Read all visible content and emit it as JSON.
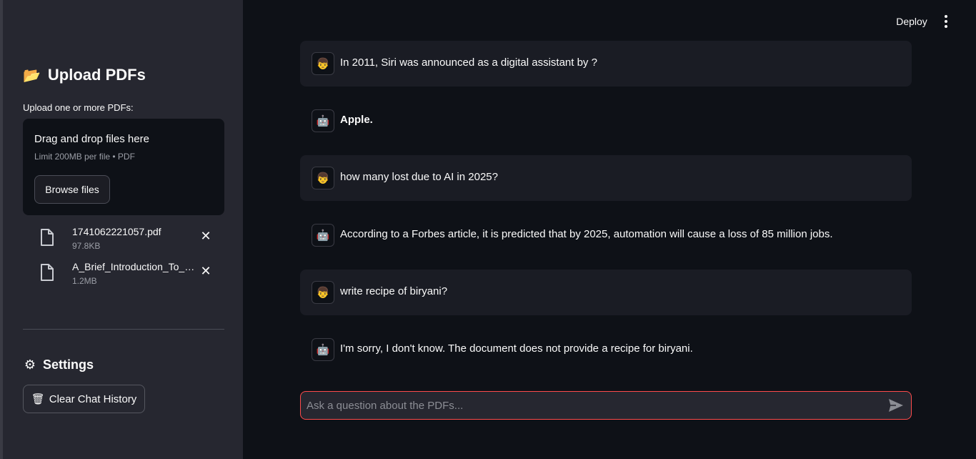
{
  "sidebar": {
    "title": "Upload PDFs",
    "title_icon": "folder-icon",
    "upload_label": "Upload one or more PDFs:",
    "dropzone": {
      "main_text": "Drag and drop files here",
      "limit_text": "Limit 200MB per file • PDF",
      "browse_label": "Browse files"
    },
    "files": [
      {
        "name": "1741062221057.pdf",
        "size": "97.8KB"
      },
      {
        "name": "A_Brief_Introduction_To_AI.pdf",
        "size": "1.2MB"
      }
    ],
    "settings_title": "Settings",
    "clear_label": "Clear Chat History"
  },
  "header": {
    "deploy_label": "Deploy"
  },
  "chat": {
    "messages": [
      {
        "role": "user",
        "avatar": "user-avatar-icon",
        "text": "In 2011, Siri was announced as a digital assistant by ?"
      },
      {
        "role": "assistant",
        "avatar": "bot-avatar-icon",
        "text": "Apple."
      },
      {
        "role": "user",
        "avatar": "user-avatar-icon",
        "text": "how many lost due to AI in 2025?"
      },
      {
        "role": "assistant",
        "avatar": "bot-avatar-icon",
        "text": "According to a Forbes article, it is predicted that by 2025, automation will cause a loss of 85 million jobs."
      },
      {
        "role": "user",
        "avatar": "user-avatar-icon",
        "text": "write recipe of biryani?"
      },
      {
        "role": "assistant",
        "avatar": "bot-avatar-icon",
        "text": "I'm sorry, I don't know. The document does not provide a recipe for biryani."
      }
    ],
    "input_placeholder": "Ask a question about the PDFs...",
    "input_value": ""
  },
  "colors": {
    "background": "#0e1117",
    "sidebar": "#262730",
    "accent": "#ff4b4b",
    "user_message_bg": "#1a1c24"
  }
}
